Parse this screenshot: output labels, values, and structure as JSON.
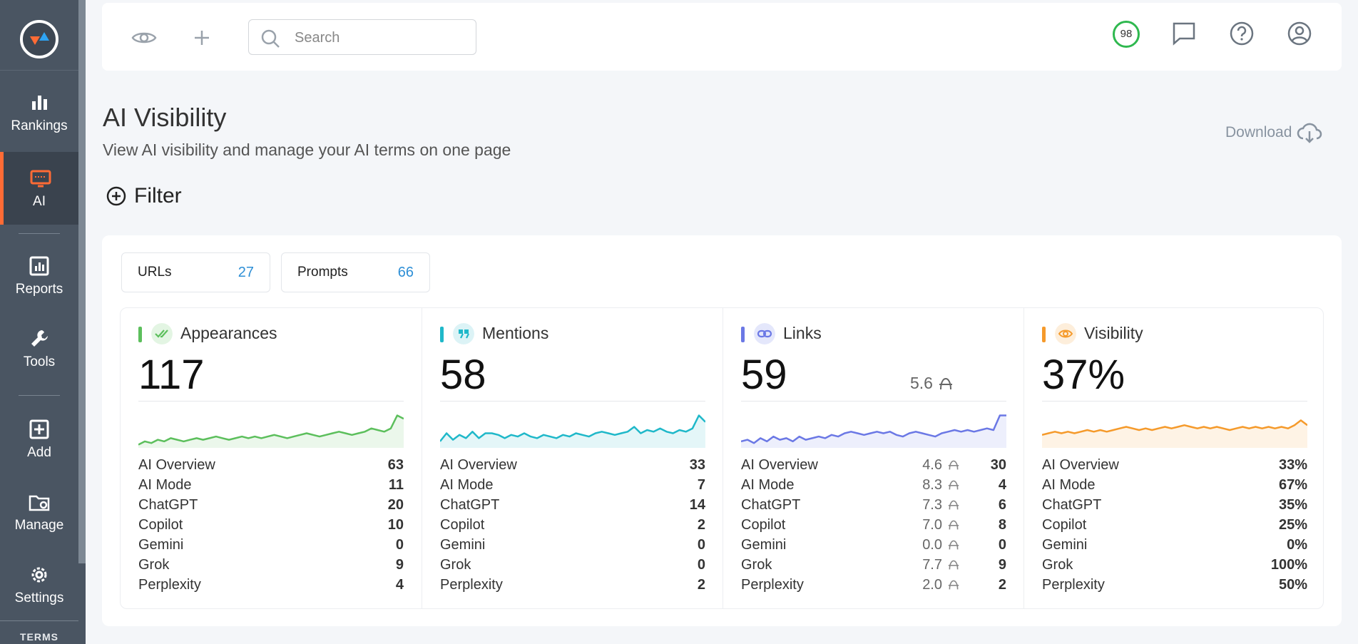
{
  "sidebar": {
    "items": [
      {
        "label": "Rankings"
      },
      {
        "label": "AI"
      },
      {
        "label": "Reports"
      },
      {
        "label": "Tools"
      },
      {
        "label": "Add"
      },
      {
        "label": "Manage"
      },
      {
        "label": "Settings"
      }
    ],
    "footer": "TERMS",
    "active_color": "#ff6b35"
  },
  "topbar": {
    "search_placeholder": "Search",
    "score": "98",
    "score_color": "#2fb84f"
  },
  "header": {
    "title": "AI Visibility",
    "subtitle": "View AI visibility and manage your AI terms on one page",
    "download_label": "Download",
    "filter_label": "Filter"
  },
  "summary": {
    "urls_label": "URLs",
    "urls_count": "27",
    "prompts_label": "Prompts",
    "prompts_count": "66"
  },
  "cards": [
    {
      "title": "Appearances",
      "value": "117",
      "color": "#5cbf5c",
      "icon": "double-check-icon",
      "sparkline": [
        2,
        4,
        3,
        5,
        4,
        6,
        5,
        4,
        5,
        6,
        5,
        6,
        7,
        6,
        5,
        6,
        7,
        6,
        7,
        6,
        7,
        8,
        7,
        6,
        7,
        8,
        9,
        8,
        7,
        8,
        9,
        10,
        9,
        8,
        9,
        10,
        12,
        11,
        10,
        12,
        20,
        18
      ],
      "rows": [
        {
          "label": "AI Overview",
          "value": "63"
        },
        {
          "label": "AI Mode",
          "value": "11"
        },
        {
          "label": "ChatGPT",
          "value": "20"
        },
        {
          "label": "Copilot",
          "value": "10"
        },
        {
          "label": "Gemini",
          "value": "0"
        },
        {
          "label": "Grok",
          "value": "9"
        },
        {
          "label": "Perplexity",
          "value": "4"
        }
      ]
    },
    {
      "title": "Mentions",
      "value": "58",
      "color": "#1fb8c9",
      "icon": "quote-icon",
      "sparkline": [
        4,
        9,
        5,
        8,
        6,
        10,
        6,
        9,
        9,
        8,
        6,
        8,
        7,
        9,
        7,
        6,
        8,
        7,
        6,
        8,
        7,
        9,
        8,
        7,
        9,
        10,
        9,
        8,
        9,
        10,
        13,
        9,
        11,
        10,
        12,
        10,
        9,
        11,
        10,
        12,
        20,
        16
      ],
      "rows": [
        {
          "label": "AI Overview",
          "value": "33"
        },
        {
          "label": "AI Mode",
          "value": "7"
        },
        {
          "label": "ChatGPT",
          "value": "14"
        },
        {
          "label": "Copilot",
          "value": "2"
        },
        {
          "label": "Gemini",
          "value": "0"
        },
        {
          "label": "Grok",
          "value": "0"
        },
        {
          "label": "Perplexity",
          "value": "2"
        }
      ]
    },
    {
      "title": "Links",
      "value": "59",
      "extra": "5.6",
      "color": "#6b78e5",
      "icon": "link-icon",
      "sparkline": [
        4,
        5,
        3,
        6,
        4,
        7,
        5,
        6,
        4,
        7,
        5,
        6,
        7,
        6,
        8,
        7,
        9,
        10,
        9,
        8,
        9,
        10,
        9,
        10,
        8,
        7,
        9,
        10,
        9,
        8,
        7,
        9,
        10,
        11,
        10,
        11,
        10,
        11,
        12,
        11,
        20,
        20
      ],
      "rows": [
        {
          "label": "AI Overview",
          "sub": "4.6",
          "value": "30"
        },
        {
          "label": "AI Mode",
          "sub": "8.3",
          "value": "4"
        },
        {
          "label": "ChatGPT",
          "sub": "7.3",
          "value": "6"
        },
        {
          "label": "Copilot",
          "sub": "7.0",
          "value": "8"
        },
        {
          "label": "Gemini",
          "sub": "0.0",
          "value": "0"
        },
        {
          "label": "Grok",
          "sub": "7.7",
          "value": "9"
        },
        {
          "label": "Perplexity",
          "sub": "2.0",
          "value": "2"
        }
      ]
    },
    {
      "title": "Visibility",
      "value": "37%",
      "color": "#f59a2b",
      "icon": "eye-icon",
      "sparkline": [
        8,
        9,
        10,
        9,
        10,
        9,
        10,
        11,
        10,
        11,
        10,
        11,
        12,
        13,
        12,
        11,
        12,
        11,
        12,
        13,
        12,
        13,
        14,
        13,
        12,
        13,
        12,
        13,
        12,
        11,
        12,
        13,
        12,
        13,
        12,
        13,
        12,
        13,
        12,
        14,
        17,
        14
      ],
      "rows": [
        {
          "label": "AI Overview",
          "value": "33%"
        },
        {
          "label": "AI Mode",
          "value": "67%"
        },
        {
          "label": "ChatGPT",
          "value": "35%"
        },
        {
          "label": "Copilot",
          "value": "25%"
        },
        {
          "label": "Gemini",
          "value": "0%"
        },
        {
          "label": "Grok",
          "value": "100%"
        },
        {
          "label": "Perplexity",
          "value": "50%"
        }
      ]
    }
  ]
}
